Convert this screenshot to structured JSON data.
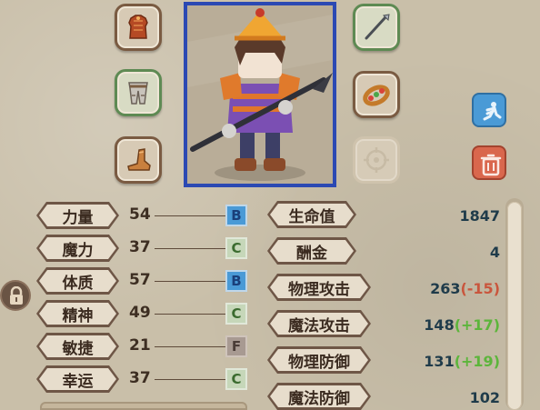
{
  "stats": [
    {
      "label": "力量",
      "value": "54",
      "grade": "B"
    },
    {
      "label": "魔力",
      "value": "37",
      "grade": "C"
    },
    {
      "label": "体质",
      "value": "57",
      "grade": "B"
    },
    {
      "label": "精神",
      "value": "49",
      "grade": "C"
    },
    {
      "label": "敏捷",
      "value": "21",
      "grade": "F"
    },
    {
      "label": "幸运",
      "value": "37",
      "grade": "C"
    }
  ],
  "attributes": [
    {
      "label": "生命值",
      "value": "1847",
      "modifier": ""
    },
    {
      "label": "酬金",
      "value": "4",
      "modifier": ""
    },
    {
      "label": "物理攻击",
      "value": "263",
      "modifier": "(-15)"
    },
    {
      "label": "魔法攻击",
      "value": "148",
      "modifier": "(+17)"
    },
    {
      "label": "物理防御",
      "value": "131",
      "modifier": "(+19)"
    },
    {
      "label": "魔法防御",
      "value": "102",
      "modifier": ""
    }
  ],
  "equipment": {
    "armor": "armor-icon",
    "legs": "leg-armor-icon",
    "boots": "boots-icon",
    "weapon": "spear-icon",
    "accessory": "bracelet-icon",
    "empty": "empty-slot-icon"
  },
  "colors": {
    "portrait_border": "#2b49b3",
    "grade_B": "#4a9ad6",
    "grade_C": "#c6d7b9",
    "grade_F": "#a89a92",
    "positive": "#5cb53b",
    "negative": "#c9563d",
    "dismiss_button": "#d9674d",
    "skill_button": "#4a9ad6"
  }
}
